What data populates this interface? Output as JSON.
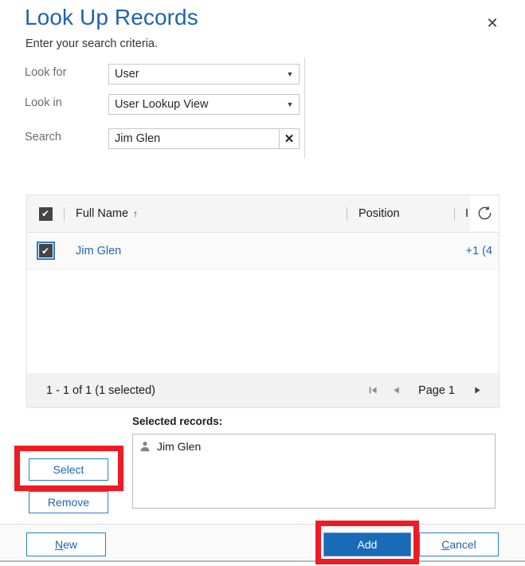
{
  "dialog": {
    "title": "Look Up Records",
    "subtitle": "Enter your search criteria.",
    "close_icon": "close-icon"
  },
  "criteria": {
    "look_for": {
      "label": "Look for",
      "value": "User",
      "caret_icon": "chevron-down-icon"
    },
    "look_in": {
      "label": "Look in",
      "value": "User Lookup View",
      "caret_icon": "chevron-down-icon"
    },
    "search": {
      "label": "Search",
      "value": "Jim Glen",
      "clear_icon": "clear-x-icon"
    }
  },
  "grid": {
    "header": {
      "select_all_checked": true,
      "check_glyph": "✔",
      "columns": [
        {
          "label": "Full Name",
          "sort_glyph": "↑"
        },
        {
          "label": "Position",
          "sort_glyph": ""
        },
        {
          "label": "I",
          "sort_glyph": ""
        }
      ],
      "refresh_icon": "refresh-icon"
    },
    "rows": [
      {
        "checked": true,
        "check_glyph": "✔",
        "full_name": "Jim Glen",
        "phone": "+1 (4"
      }
    ],
    "hscroll": {
      "left_arrow": "◀",
      "right_arrow": "▶"
    },
    "footer": {
      "record_count": "1 - 1 of 1 (1 selected)",
      "first_page_icon": "▌◀",
      "prev_page_icon": "◀",
      "page_label": "Page 1",
      "next_page_icon": "▶"
    }
  },
  "selected": {
    "label": "Selected records:",
    "items": [
      {
        "name": "Jim Glen",
        "icon": "person-icon"
      }
    ]
  },
  "side_actions": {
    "select_label": "Select",
    "remove_label": "Remove"
  },
  "bottom_bar": {
    "new": {
      "accel": "N",
      "rest": "ew"
    },
    "add_label": "Add",
    "cancel": {
      "accel": "C",
      "rest": "ancel"
    }
  },
  "colors": {
    "title_blue": "#1f63b0",
    "link_blue": "#2266b8",
    "primary_button": "#1a6bb5",
    "annotation_red": "#ef1b24"
  }
}
